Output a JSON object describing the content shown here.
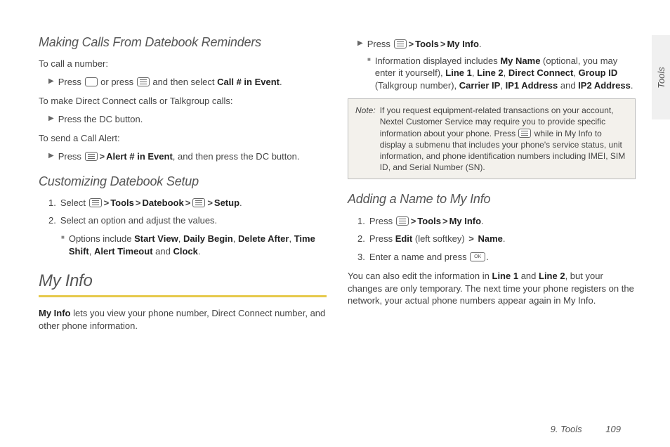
{
  "sidetab": "Tools",
  "footer": {
    "chapter": "9. Tools",
    "page": "109"
  },
  "left": {
    "h1": "Making Calls From Datebook Reminders",
    "p1": "To call a number:",
    "b1_pre": "Press ",
    "b1_mid": " or press ",
    "b1_post": " and then select ",
    "b1_bold": "Call # in Event",
    "b1_end": ".",
    "p2": "To make Direct Connect calls or Talkgroup calls:",
    "b2": "Press the DC button.",
    "p3": "To send a Call Alert:",
    "b3_pre": "Press ",
    "b3_bold": "Alert # in Event",
    "b3_post": ", and then press the DC button.",
    "h2": "Customizing Datebook Setup",
    "n1_pre": "Select ",
    "n1_tools": "Tools",
    "n1_datebook": "Datebook",
    "n1_setup": "Setup",
    "n1_end": ".",
    "n2": "Select an option and adjust the values.",
    "sub_pre": "Options include ",
    "sub_o1": "Start View",
    "sub_o2": "Daily Begin",
    "sub_o3": "Delete After",
    "sub_o4": "Time Shift",
    "sub_o5": "Alert Timeout",
    "sub_and": " and ",
    "sub_o6": "Clock",
    "sub_end": ".",
    "h3": "My Info",
    "p4_bold": "My Info",
    "p4_rest": " lets you view your phone number, Direct Connect number, and other phone information."
  },
  "right": {
    "b1_pre": "Press ",
    "b1_tools": "Tools",
    "b1_myinfo": "My Info",
    "b1_end": ".",
    "sub_pre": "Information displayed includes ",
    "sub_myname": "My Name",
    "sub_opt": " (optional, you may enter it yourself), ",
    "sub_l1": "Line 1",
    "sub_l2": "Line 2",
    "sub_dc": "Direct Connect",
    "sub_gid": "Group ID",
    "sub_gid_par": " (Talkgroup number), ",
    "sub_cip": "Carrier IP",
    "sub_ip1": "IP1 Address",
    "sub_and": " and ",
    "sub_ip2": "IP2 Address",
    "sub_end": ".",
    "note_label": "Note:",
    "note_pre": "If you request equipment-related transactions on your account, Nextel Customer Service may require you to provide specific information about your phone. Press ",
    "note_post": " while in My Info to display a submenu that includes your phone's service status, unit information, and phone identification numbers including IMEI, SIM ID, and Serial Number (SN).",
    "h1": "Adding a Name to My Info",
    "n1_pre": "Press ",
    "n1_tools": "Tools",
    "n1_myinfo": "My Info",
    "n1_end": ".",
    "n2_pre": "Press ",
    "n2_edit": "Edit",
    "n2_mid": " (left softkey) ",
    "n2_name": "Name",
    "n2_end": ".",
    "n3_pre": "Enter a name and press ",
    "n3_end": ".",
    "p_pre": "You can also edit the information in ",
    "p_l1": "Line 1",
    "p_and": " and ",
    "p_l2": "Line 2",
    "p_rest": ", but your changes are only temporary. The next time your phone registers on the network, your actual phone numbers appear again in My Info."
  }
}
